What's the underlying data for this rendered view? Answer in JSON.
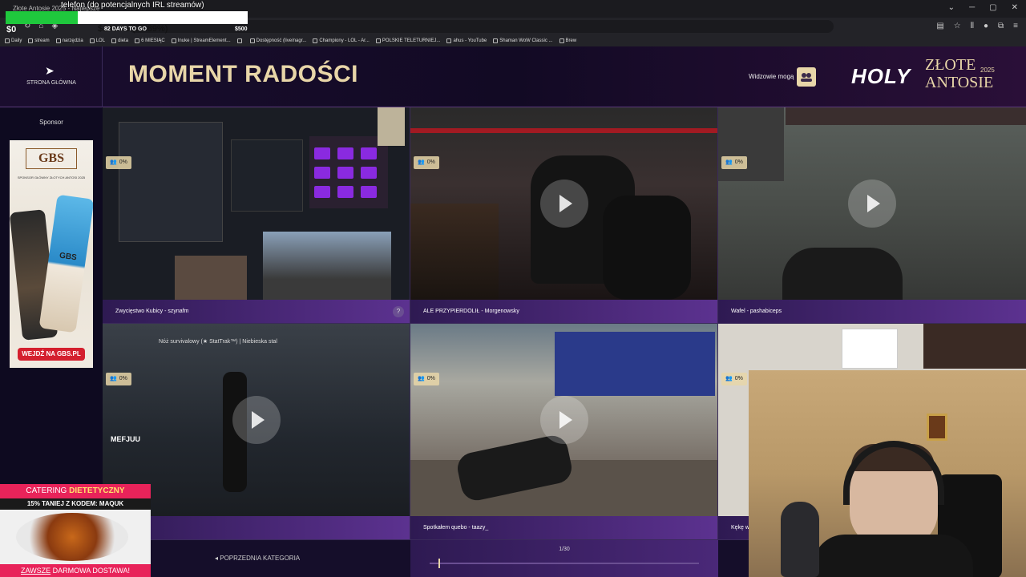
{
  "browser": {
    "tab_title": "Złote Antosie 2025 - Najlepsze",
    "bookmarks": [
      {
        "label": "Daily",
        "icon": "folder-icon"
      },
      {
        "label": "stream",
        "icon": "folder-icon"
      },
      {
        "label": "narzędzia",
        "icon": "folder-icon"
      },
      {
        "label": "LOL",
        "icon": "folder-icon"
      },
      {
        "label": "dieta",
        "icon": "folder-icon"
      },
      {
        "label": "6 MIESIĄC",
        "icon": "site-icon"
      },
      {
        "label": "Inuke | StreamElement...",
        "icon": "site-icon"
      },
      {
        "label": "",
        "icon": "folder-icon"
      },
      {
        "label": "Dostępność (live/nagr...",
        "icon": "site-icon"
      },
      {
        "label": "Championy - LOL - Ar...",
        "icon": "site-icon"
      },
      {
        "label": "POLSKIE TELETURNIEJ...",
        "icon": "site-icon"
      },
      {
        "label": "ahus - YouTube",
        "icon": "site-icon"
      },
      {
        "label": "Shaman WoW Classic ...",
        "icon": "site-icon"
      },
      {
        "label": "Brew",
        "icon": "site-icon"
      }
    ]
  },
  "stream_overlay": {
    "phone_label": "telefon (do potencjalnych IRL streamów)",
    "amount": "$149.43 (29.89%)",
    "progress_fraction": 0.2989,
    "current": "$0",
    "days_to_go": "82 DAYS TO GO",
    "goal": "$500"
  },
  "header": {
    "home_label": "STRONA GŁÓWNA",
    "title": "MOMENT RADOŚCI",
    "viewers_label": "Widzowie mogą",
    "logo_brand": "HOLY",
    "logo_line1": "ZŁOTE",
    "logo_line2": "ANTOSIE",
    "logo_year": "2025"
  },
  "sidebar": {
    "sponsor_label": "Sponsor",
    "ad": {
      "brand": "GBS",
      "text": "SPONSOR GŁÓWNY ZŁOTYCH ANTOSI 2025",
      "can_text": "GBS",
      "cta": "WEJDŹ NA GBS.PL"
    }
  },
  "tiles": [
    {
      "caption": "Zwycięstwo Kubicy - szynafm",
      "pct": "0%",
      "has_help": true
    },
    {
      "caption": "ALE PRZYPIERDOLIŁ - Morgenowsky",
      "pct": "0%",
      "has_help": false
    },
    {
      "caption": "Wafel - pashabiceps",
      "pct": "0%",
      "has_help": false
    },
    {
      "caption": "",
      "pct": "0%",
      "has_help": false,
      "item_name": "Nóż survivalowy (★ StatTrak™) | Niebieska stal",
      "streamer_tag": "MEFJUU"
    },
    {
      "caption": "Spotkałem quebo - taazy_",
      "pct": "0%",
      "has_help": false
    },
    {
      "caption": "Kękę w",
      "pct": "0%",
      "has_help": false
    }
  ],
  "help_glyph": "?",
  "catering": {
    "title_a": "CATERING ",
    "title_b": "DIETETYCZNY",
    "code": "15% TANIEJ Z KODEM: MAQUK",
    "bottom_a": "ZAWSZE",
    "bottom_b": " DARMOWA DOSTAWA!"
  },
  "pager": {
    "prev_label": "POPRZEDNIA KATEGORIA",
    "count": "1/30",
    "fraction": 0.033
  },
  "colors": {
    "gold": "#e8d6a8",
    "purple": "#4a2878",
    "catering_pink": "#e8235a",
    "progress_green": "#1fc83d"
  }
}
